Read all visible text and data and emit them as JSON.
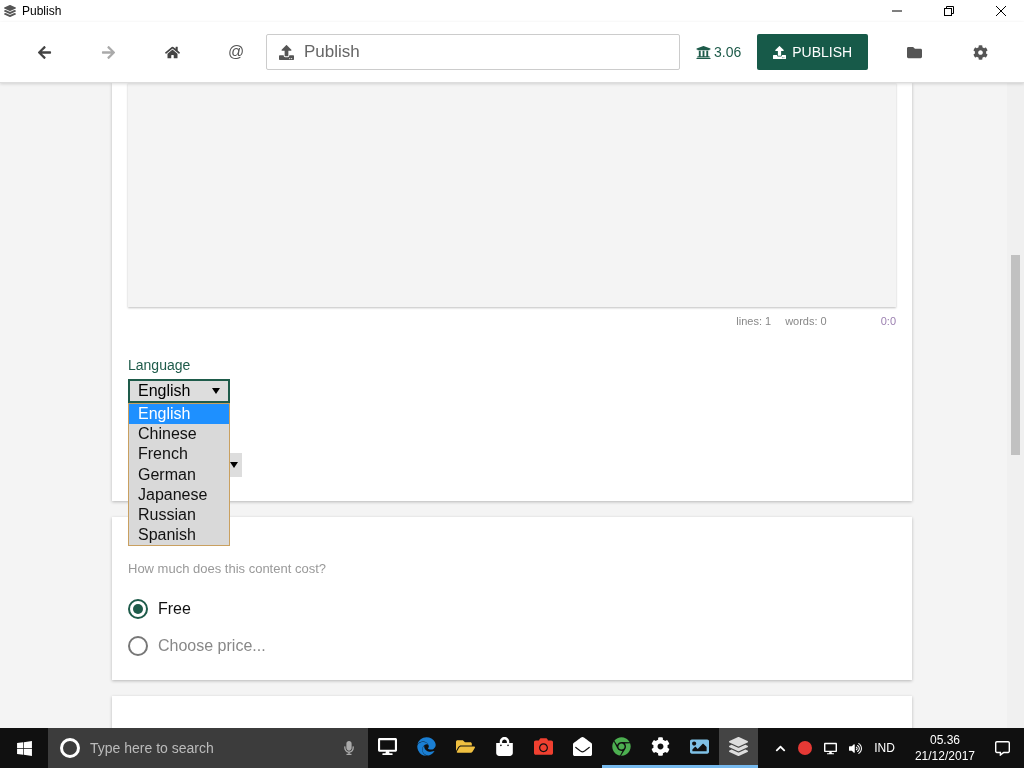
{
  "window": {
    "title": "Publish"
  },
  "toolbar": {
    "nav": [
      {
        "kind": "back",
        "disabled": false
      },
      {
        "kind": "forward",
        "disabled": true
      },
      {
        "kind": "home",
        "disabled": false
      }
    ],
    "mention": "@",
    "address": "Publish",
    "balance": "3.06",
    "publish_button": "PUBLISH"
  },
  "editor": {
    "lines": "lines: 1",
    "words": "words: 0",
    "cursor": "0:0"
  },
  "language": {
    "label": "Language",
    "value": "English",
    "expanded": true,
    "options": [
      {
        "label": "English",
        "selected": true
      },
      {
        "label": "Chinese",
        "selected": false
      },
      {
        "label": "French",
        "selected": false
      },
      {
        "label": "German",
        "selected": false
      },
      {
        "label": "Japanese",
        "selected": false
      },
      {
        "label": "Russian",
        "selected": false
      },
      {
        "label": "Spanish",
        "selected": false
      }
    ]
  },
  "price": {
    "subtitle": "How much does this content cost?",
    "options": [
      {
        "label": "Free",
        "selected": true
      },
      {
        "label": "Choose price...",
        "selected": false
      }
    ]
  },
  "taskbar": {
    "search_placeholder": "Type here to search",
    "apps": [
      {
        "kind": "taskview",
        "running": false,
        "selected": false
      },
      {
        "kind": "edge",
        "running": false,
        "selected": false
      },
      {
        "kind": "explorer",
        "running": false,
        "selected": false
      },
      {
        "kind": "store",
        "running": false,
        "selected": false
      },
      {
        "kind": "recorder",
        "running": false,
        "selected": false
      },
      {
        "kind": "mail",
        "running": false,
        "selected": false
      },
      {
        "kind": "chrome",
        "running": true,
        "selected": false
      },
      {
        "kind": "settings",
        "running": true,
        "selected": false
      },
      {
        "kind": "photos",
        "running": true,
        "selected": false
      },
      {
        "kind": "publish",
        "running": true,
        "selected": true
      }
    ],
    "language": "IND",
    "time": "05.36",
    "date": "21/12/2017"
  }
}
